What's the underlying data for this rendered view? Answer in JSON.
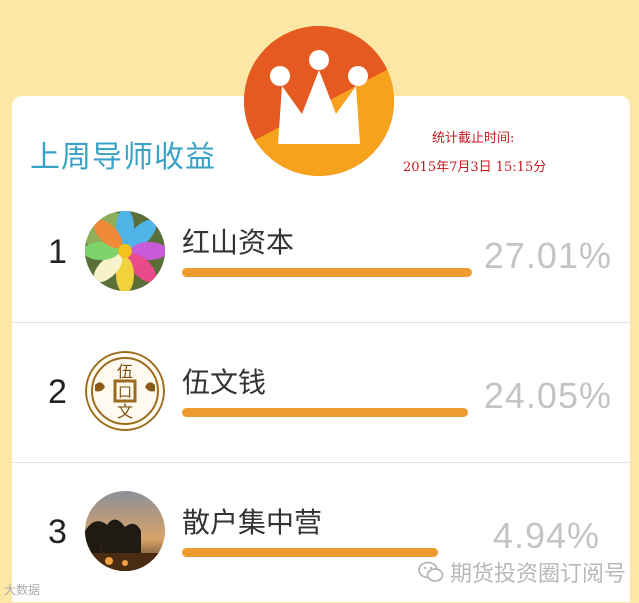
{
  "header": {
    "title": "上周导师收益",
    "stat_label": "统计截止时间:",
    "stat_time": "2015年7月3日  15:15分"
  },
  "colors": {
    "background": "#fde7a6",
    "title": "#3aa2c7",
    "stat_text": "#c8191e",
    "bar": "#ef9a2e",
    "percent": "#c4c4c4",
    "crown_circle": "#f37e1f"
  },
  "ranking": [
    {
      "rank": "1",
      "name": "红山资本",
      "percent": "27.01%",
      "value": 27.01,
      "avatar_icon": "flower-avatar"
    },
    {
      "rank": "2",
      "name": "伍文钱",
      "percent": "24.05%",
      "value": 24.05,
      "avatar_icon": "coin-avatar",
      "avatar_text": [
        "伍",
        "口",
        "文"
      ]
    },
    {
      "rank": "3",
      "name": "散户集中营",
      "percent": "4.94%",
      "value": 4.94,
      "avatar_icon": "sunset-tree-avatar"
    }
  ],
  "watermarks": {
    "left": "大数据",
    "right": "期货投资圈订阅号"
  }
}
